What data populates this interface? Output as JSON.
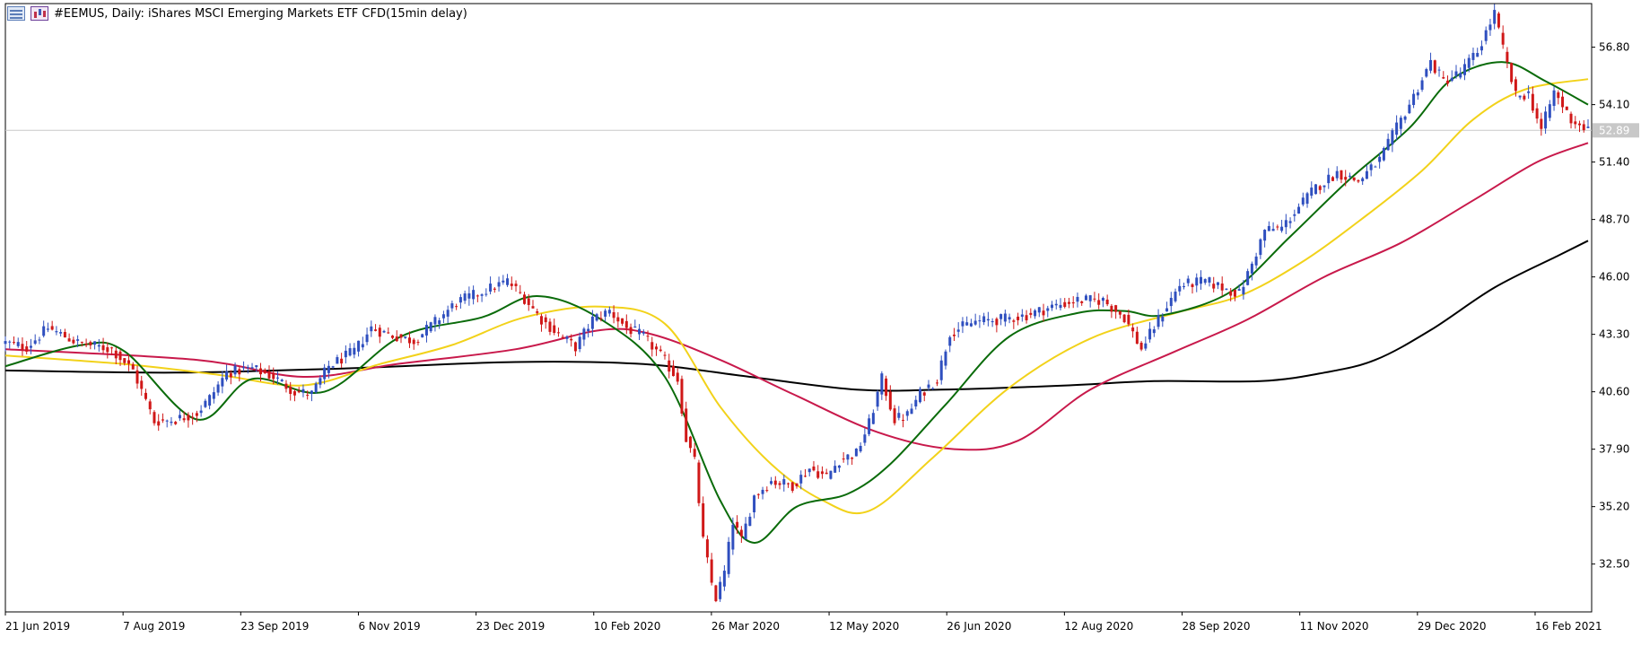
{
  "title": "#EEMUS, Daily:  iShares MSCI Emerging Markets ETF CFD(15min delay)",
  "icons": [
    "table-icon",
    "chart-icon"
  ],
  "colors": {
    "bull": "#2f4fbf",
    "bear": "#d01818",
    "ma_fast": "#0a6b0a",
    "ma_mid": "#f2d21a",
    "ma_slow": "#c8194b",
    "ma_long": "#000000",
    "price_line": "#c8c8c8",
    "price_box": "#c8c8c8"
  },
  "chart_data": {
    "type": "candlestick",
    "title": "#EEMUS, Daily:  iShares MSCI Emerging Markets ETF CFD(15min delay)",
    "x_tick_labels": [
      "21 Jun 2019",
      "7 Aug 2019",
      "23 Sep 2019",
      "6 Nov 2019",
      "23 Dec 2019",
      "10 Feb 2020",
      "26 Mar 2020",
      "12 May 2020",
      "26 Jun 2020",
      "12 Aug 2020",
      "28 Sep 2020",
      "11 Nov 2020",
      "29 Dec 2020",
      "16 Feb 2021"
    ],
    "y_tick_labels": [
      "56.80",
      "54.10",
      "51.40",
      "48.70",
      "46.00",
      "43.30",
      "40.60",
      "37.90",
      "35.20",
      "32.50"
    ],
    "y_ticks": [
      56.8,
      54.1,
      51.4,
      48.7,
      46.0,
      43.3,
      40.6,
      37.9,
      35.2,
      32.5
    ],
    "ylim": [
      30.25,
      58.85
    ],
    "current_price": 52.89,
    "current_price_label": "52.89",
    "date_range": [
      "2019-06-21",
      "2021-03-05"
    ],
    "price_path": [
      [
        0,
        42.9
      ],
      [
        5,
        42.7
      ],
      [
        10,
        43.6
      ],
      [
        17,
        42.9
      ],
      [
        25,
        42.6
      ],
      [
        30,
        41.6
      ],
      [
        35,
        39.2
      ],
      [
        40,
        39.3
      ],
      [
        45,
        39.6
      ],
      [
        48,
        40.3
      ],
      [
        52,
        41.5
      ],
      [
        58,
        41.7
      ],
      [
        63,
        41.3
      ],
      [
        68,
        40.6
      ],
      [
        72,
        40.5
      ],
      [
        76,
        41.8
      ],
      [
        82,
        42.5
      ],
      [
        86,
        43.6
      ],
      [
        90,
        43.3
      ],
      [
        96,
        43.0
      ],
      [
        100,
        43.7
      ],
      [
        106,
        44.8
      ],
      [
        112,
        45.3
      ],
      [
        118,
        45.8
      ],
      [
        122,
        45.0
      ],
      [
        126,
        44.0
      ],
      [
        130,
        43.3
      ],
      [
        134,
        42.7
      ],
      [
        138,
        44.0
      ],
      [
        142,
        44.4
      ],
      [
        146,
        43.6
      ],
      [
        150,
        43.2
      ],
      [
        154,
        42.3
      ],
      [
        158,
        41.2
      ],
      [
        160,
        38.4
      ],
      [
        162,
        37.3
      ],
      [
        164,
        33.6
      ],
      [
        166,
        31.6
      ],
      [
        167,
        30.9
      ],
      [
        169,
        32.1
      ],
      [
        171,
        34.5
      ],
      [
        173,
        33.6
      ],
      [
        176,
        35.7
      ],
      [
        180,
        36.4
      ],
      [
        185,
        36.2
      ],
      [
        189,
        37.0
      ],
      [
        193,
        36.6
      ],
      [
        196,
        37.4
      ],
      [
        200,
        37.7
      ],
      [
        203,
        39.1
      ],
      [
        206,
        41.2
      ],
      [
        209,
        39.3
      ],
      [
        212,
        39.5
      ],
      [
        215,
        40.5
      ],
      [
        219,
        41.2
      ],
      [
        222,
        43.4
      ],
      [
        228,
        43.9
      ],
      [
        234,
        44.0
      ],
      [
        240,
        44.2
      ],
      [
        246,
        44.6
      ],
      [
        252,
        44.9
      ],
      [
        258,
        44.9
      ],
      [
        263,
        44.1
      ],
      [
        267,
        42.6
      ],
      [
        271,
        44.0
      ],
      [
        276,
        45.6
      ],
      [
        282,
        45.8
      ],
      [
        286,
        45.5
      ],
      [
        290,
        45.2
      ],
      [
        293,
        46.6
      ],
      [
        296,
        48.2
      ],
      [
        300,
        48.3
      ],
      [
        304,
        49.3
      ],
      [
        308,
        50.2
      ],
      [
        313,
        50.9
      ],
      [
        318,
        50.5
      ],
      [
        323,
        51.5
      ],
      [
        327,
        53.0
      ],
      [
        331,
        54.5
      ],
      [
        335,
        56.1
      ],
      [
        338,
        55.2
      ],
      [
        342,
        55.6
      ],
      [
        346,
        56.6
      ],
      [
        350,
        58.4
      ],
      [
        352,
        56.7
      ],
      [
        355,
        54.5
      ],
      [
        358,
        54.6
      ],
      [
        361,
        52.9
      ],
      [
        364,
        54.7
      ],
      [
        368,
        53.4
      ],
      [
        372,
        52.9
      ]
    ],
    "ma_fast": [
      [
        0,
        41.8
      ],
      [
        18,
        42.8
      ],
      [
        28,
        42.5
      ],
      [
        45,
        39.3
      ],
      [
        58,
        41.2
      ],
      [
        75,
        40.6
      ],
      [
        93,
        43.2
      ],
      [
        112,
        44.1
      ],
      [
        125,
        45.1
      ],
      [
        140,
        44.0
      ],
      [
        155,
        41.3
      ],
      [
        168,
        35.5
      ],
      [
        176,
        33.5
      ],
      [
        186,
        35.2
      ],
      [
        198,
        35.8
      ],
      [
        208,
        37.2
      ],
      [
        221,
        40.0
      ],
      [
        236,
        43.2
      ],
      [
        252,
        44.3
      ],
      [
        263,
        44.4
      ],
      [
        272,
        44.2
      ],
      [
        288,
        45.3
      ],
      [
        302,
        47.9
      ],
      [
        316,
        50.6
      ],
      [
        330,
        53.0
      ],
      [
        340,
        55.3
      ],
      [
        352,
        56.1
      ],
      [
        362,
        55.2
      ],
      [
        372,
        54.1
      ]
    ],
    "ma_mid": [
      [
        0,
        42.3
      ],
      [
        28,
        41.9
      ],
      [
        50,
        41.4
      ],
      [
        70,
        40.9
      ],
      [
        88,
        41.9
      ],
      [
        105,
        42.8
      ],
      [
        122,
        44.1
      ],
      [
        140,
        44.6
      ],
      [
        155,
        43.8
      ],
      [
        168,
        39.9
      ],
      [
        180,
        37.2
      ],
      [
        192,
        35.5
      ],
      [
        203,
        35.0
      ],
      [
        218,
        37.5
      ],
      [
        236,
        40.8
      ],
      [
        255,
        43.1
      ],
      [
        275,
        44.3
      ],
      [
        290,
        45.1
      ],
      [
        304,
        46.6
      ],
      [
        318,
        48.6
      ],
      [
        333,
        51.0
      ],
      [
        345,
        53.4
      ],
      [
        357,
        54.8
      ],
      [
        372,
        55.3
      ]
    ],
    "ma_slow": [
      [
        0,
        42.6
      ],
      [
        45,
        42.1
      ],
      [
        70,
        41.3
      ],
      [
        92,
        41.9
      ],
      [
        120,
        42.6
      ],
      [
        140,
        43.5
      ],
      [
        152,
        43.3
      ],
      [
        168,
        42.1
      ],
      [
        185,
        40.5
      ],
      [
        205,
        38.7
      ],
      [
        223,
        37.9
      ],
      [
        238,
        38.3
      ],
      [
        255,
        40.7
      ],
      [
        275,
        42.5
      ],
      [
        292,
        44.0
      ],
      [
        310,
        46.0
      ],
      [
        328,
        47.6
      ],
      [
        345,
        49.6
      ],
      [
        360,
        51.4
      ],
      [
        372,
        52.3
      ]
    ],
    "ma_long": [
      [
        0,
        41.6
      ],
      [
        40,
        41.5
      ],
      [
        80,
        41.7
      ],
      [
        120,
        42.0
      ],
      [
        150,
        41.9
      ],
      [
        175,
        41.3
      ],
      [
        200,
        40.7
      ],
      [
        220,
        40.7
      ],
      [
        250,
        40.9
      ],
      [
        270,
        41.1
      ],
      [
        295,
        41.1
      ],
      [
        310,
        41.5
      ],
      [
        322,
        42.1
      ],
      [
        335,
        43.5
      ],
      [
        350,
        45.5
      ],
      [
        365,
        47.0
      ],
      [
        372,
        47.7
      ]
    ]
  }
}
